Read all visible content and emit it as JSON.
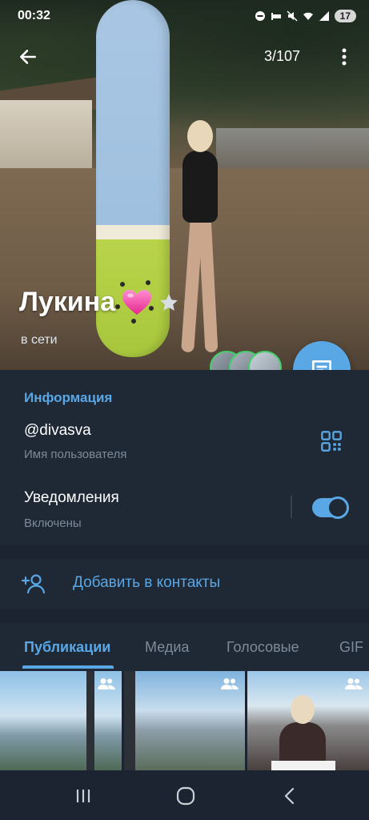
{
  "status_bar": {
    "time": "00:32",
    "battery": "17"
  },
  "topbar": {
    "photo_counter": "3/107"
  },
  "profile": {
    "name": "Лукина",
    "status": "в сети"
  },
  "info": {
    "section_title": "Информация",
    "username": "@divasva",
    "username_label": "Имя пользователя",
    "notifications_title": "Уведомления",
    "notifications_status": "Включены",
    "notifications_enabled": true
  },
  "add_contact": {
    "label": "Добавить в контакты"
  },
  "tabs": [
    {
      "label": "Публикации",
      "active": true
    },
    {
      "label": "Медиа",
      "active": false
    },
    {
      "label": "Голосовые",
      "active": false
    },
    {
      "label": "GIF",
      "active": false
    }
  ],
  "colors": {
    "accent": "#5aa7e6",
    "background": "#1b2430",
    "card": "#1f2935",
    "secondary_text": "#7d8a99",
    "story_ring": "#43d06b"
  },
  "icons": {
    "back": "arrow-left-icon",
    "more": "more-vertical-icon",
    "message": "chat-bubble-icon",
    "qr": "qr-code-icon",
    "add_contact": "add-person-icon",
    "group": "group-icon",
    "star": "star-icon",
    "heart": "heart-emoji-icon"
  }
}
